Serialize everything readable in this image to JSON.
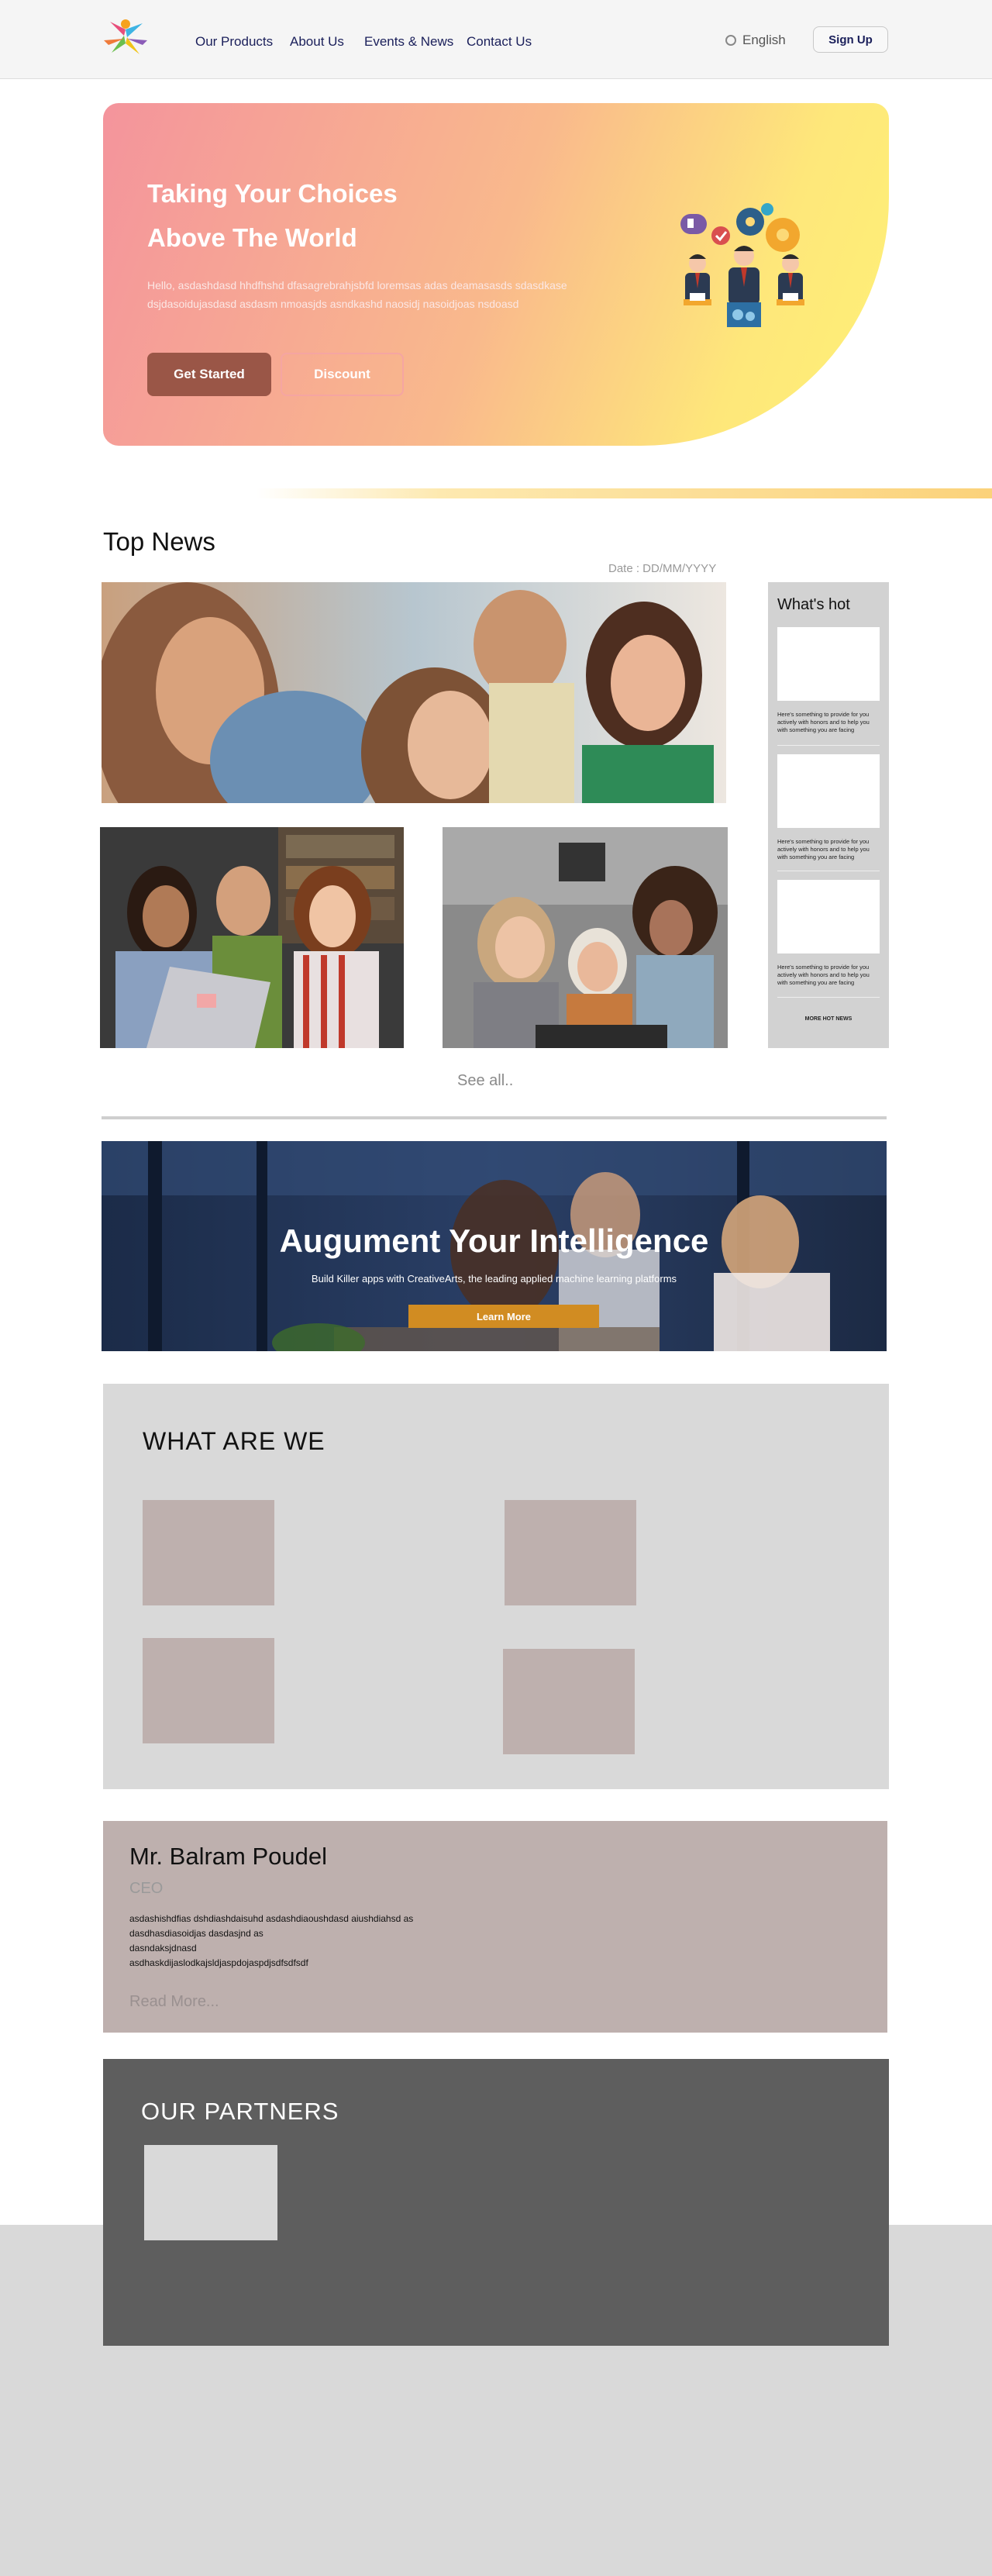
{
  "header": {
    "nav": [
      "Our Products",
      "About Us",
      "Events & News",
      "Contact Us"
    ],
    "language": "English",
    "signup_label": "Sign Up"
  },
  "hero": {
    "title_line1": "Taking Your Choices",
    "title_line2": "Above The World",
    "text": "Hello, asdashdasd hhdfhshd dfasagrebrahjsbfd loremsas adas deamasasds sdasdkase dsjdasoidujasdasd asdasm nmoasjds asndkashd naosidj nasoidjoas nsdoasd",
    "get_started_label": "Get Started",
    "discount_label": "Discount"
  },
  "top_news": {
    "title": "Top News",
    "date_label": "Date : DD/MM/YYYY",
    "see_all": "See all.."
  },
  "whats_hot": {
    "title": "What's hot",
    "items": [
      {
        "text": "Here's something to provide for you actively with honors and to help you with something you are facing"
      },
      {
        "text": "Here's something to provide for you actively with honors and to help you with something you are facing"
      },
      {
        "text": "Here's something to provide for you actively with honors and to help you with something you are facing"
      }
    ],
    "more_label": "MORE HOT NEWS"
  },
  "banner": {
    "title": "Augument Your Intelligence",
    "subtitle": "Build Killer apps with CreativeArts, the leading applied machine learning platforms",
    "button_label": "Learn More"
  },
  "what_are_we": {
    "title": "WHAT ARE WE"
  },
  "ceo": {
    "name": "Mr. Balram Poudel",
    "role": "CEO",
    "text_lines": [
      "asdashishdfias dshdiashdaisuhd asdashdiaoushdasd aiushdiahsd as",
      "dasdhasdiasoidjas dasdasjnd as",
      "dasndaksjdnasd",
      "asdhaskdijaslodkajsldjaspdojaspdjsdfsdfsdf"
    ],
    "read_more": "Read More..."
  },
  "partners": {
    "title": "OUR PARTNERS"
  },
  "colors": {
    "nav_text": "#1a1f5a",
    "hero_button": "#9a5647",
    "banner_button": "#d18c22",
    "section_gray": "#d9d9d9",
    "ceo_bg": "#beb0ae",
    "partners_bg": "#5e5e5e"
  }
}
